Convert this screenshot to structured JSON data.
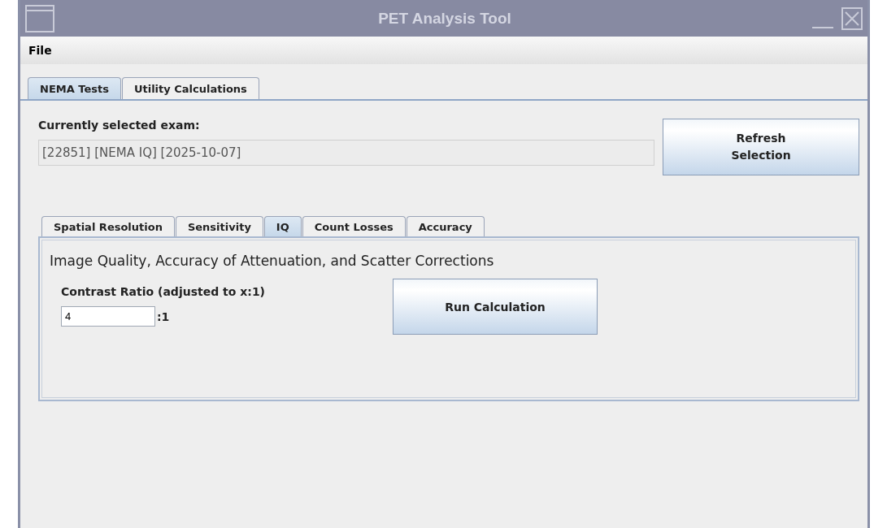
{
  "window": {
    "title": "PET Analysis Tool"
  },
  "menu": [
    "File"
  ],
  "tabs": [
    {
      "label": "NEMA Tests",
      "selected": true
    },
    {
      "label": "Utility Calculations",
      "selected": false
    }
  ],
  "exam": {
    "label": "Currently selected exam:",
    "value": "[22851] [NEMA IQ] [2025-10-07]"
  },
  "refresh_button": "Refresh Selection",
  "subtabs": [
    {
      "label": "Spatial Resolution",
      "selected": false
    },
    {
      "label": "Sensitivity",
      "selected": false
    },
    {
      "label": "IQ",
      "selected": true
    },
    {
      "label": "Count Losses",
      "selected": false
    },
    {
      "label": "Accuracy",
      "selected": false
    }
  ],
  "panel": {
    "heading": "Image Quality, Accuracy of Attenuation, and Scatter Corrections",
    "ratio_label": "Contrast Ratio (adjusted to x:1)",
    "ratio_value": "4",
    "ratio_suffix": ":1",
    "run_button": "Run Calculation"
  }
}
